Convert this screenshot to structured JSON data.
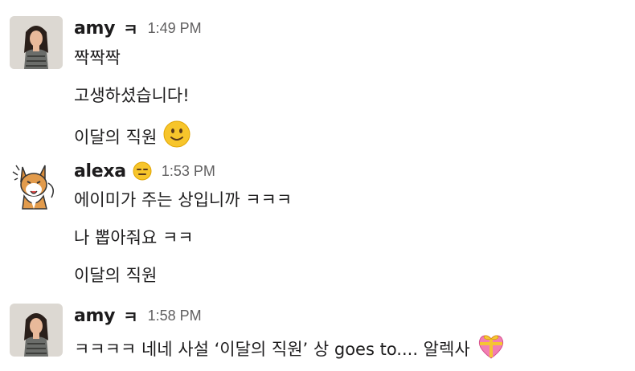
{
  "messages": [
    {
      "author": "amy",
      "status_text": "ㅋ",
      "time": "1:49 PM",
      "lines": [
        "짝짝짝",
        "고생하셨습니다!",
        "이달의 직원"
      ],
      "line_emojis": [
        "",
        "",
        "slightly-smiling-face"
      ]
    },
    {
      "author": "alexa",
      "status_emoji": "expressionless-face",
      "time": "1:53 PM",
      "lines": [
        "에이미가 주는 상입니까 ㅋㅋㅋ",
        "나 뽑아줘요 ㅋㅋ",
        "이달의 직원"
      ]
    },
    {
      "author": "amy",
      "status_text": "ㅋ",
      "time": "1:58 PM",
      "lines": [
        "ㅋㅋㅋㅋ 네네 사설 ‘이달의 직원’ 상 goes to.... 알렉사"
      ],
      "line_emojis": [
        "gift-heart"
      ]
    }
  ],
  "colors": {
    "text": "#1d1c1d",
    "timestamp": "#616061",
    "emoji_yellow": "#f7c52b"
  }
}
